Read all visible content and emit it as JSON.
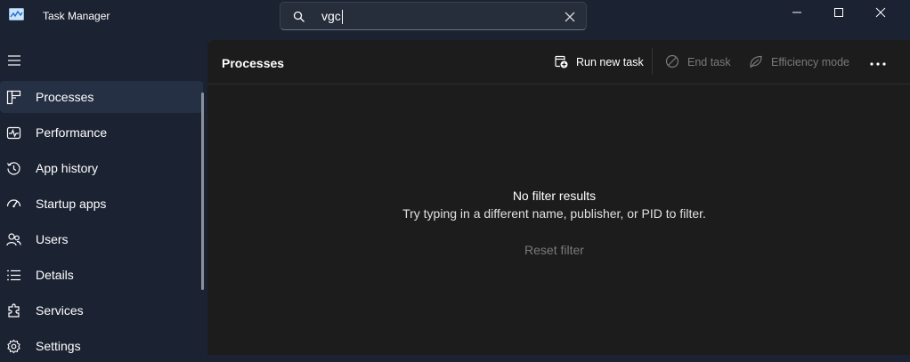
{
  "window": {
    "title": "Task Manager"
  },
  "search": {
    "value": "vgc",
    "icon": "search-icon"
  },
  "window_controls": [
    "minimize-icon",
    "maximize-icon",
    "close-icon"
  ],
  "sidebar": {
    "items": [
      {
        "label": "Processes",
        "icon": "processes-icon",
        "active": true
      },
      {
        "label": "Performance",
        "icon": "performance-icon",
        "active": false
      },
      {
        "label": "App history",
        "icon": "app-history-icon",
        "active": false
      },
      {
        "label": "Startup apps",
        "icon": "startup-apps-icon",
        "active": false
      },
      {
        "label": "Users",
        "icon": "users-icon",
        "active": false
      },
      {
        "label": "Details",
        "icon": "details-icon",
        "active": false
      },
      {
        "label": "Services",
        "icon": "services-icon",
        "active": false
      }
    ],
    "settings_label": "Settings"
  },
  "main": {
    "title": "Processes",
    "commands": {
      "run_new_task": "Run new task",
      "end_task": "End task",
      "efficiency_mode": "Efficiency mode"
    },
    "empty_state": {
      "title": "No filter results",
      "subtitle": "Try typing in a different name, publisher, or PID to filter.",
      "reset_label": "Reset filter"
    }
  },
  "colors": {
    "background": "#1b2232",
    "content": "#1c1c1c",
    "active_nav": "#263044",
    "disabled_text": "#7a7a7a"
  }
}
